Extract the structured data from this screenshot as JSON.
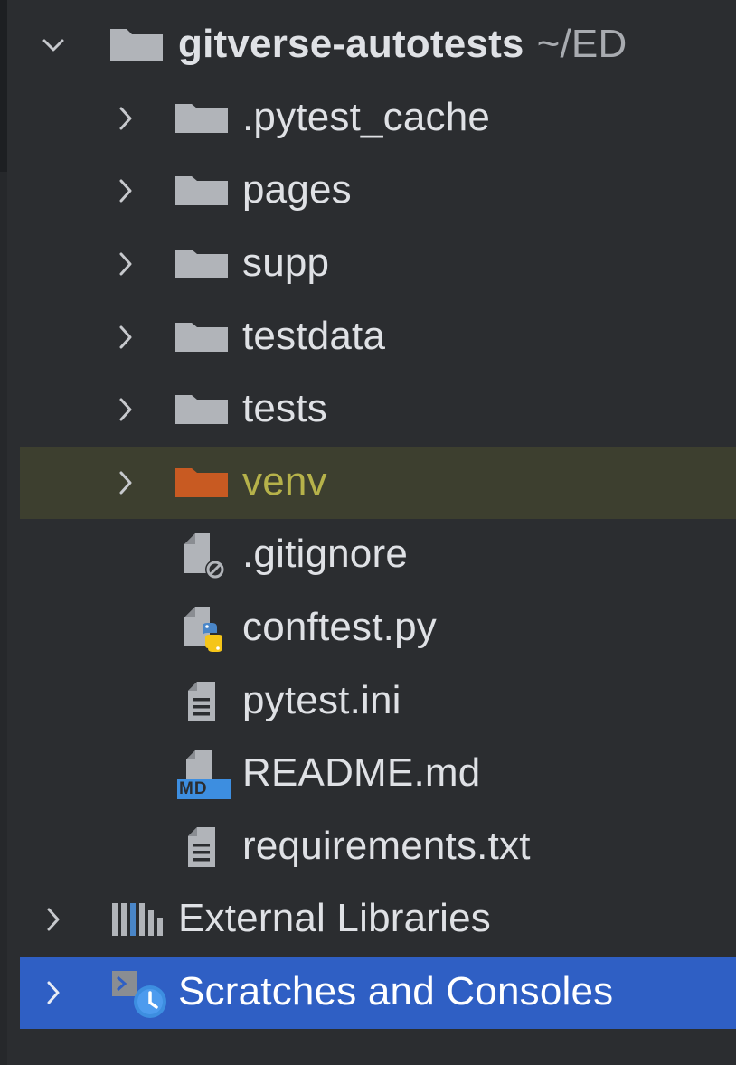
{
  "project": {
    "name": "gitverse-autotests",
    "path": "~/ED"
  },
  "folders": [
    {
      "label": ".pytest_cache"
    },
    {
      "label": "pages"
    },
    {
      "label": "supp"
    },
    {
      "label": "testdata"
    },
    {
      "label": "tests"
    },
    {
      "label": "venv",
      "excluded": true
    }
  ],
  "files": [
    {
      "label": ".gitignore",
      "icon": "gitignore-file-icon"
    },
    {
      "label": "conftest.py",
      "icon": "python-file-icon"
    },
    {
      "label": "pytest.ini",
      "icon": "text-file-icon"
    },
    {
      "label": "README.md",
      "icon": "markdown-file-icon",
      "badge": "MD"
    },
    {
      "label": "requirements.txt",
      "icon": "text-file-icon"
    }
  ],
  "external_libraries": {
    "label": "External Libraries"
  },
  "scratches": {
    "label": "Scratches and Consoles"
  },
  "colors": {
    "background": "#2b2d30",
    "folder": "#b1b4b9",
    "excluded_folder": "#c85a22",
    "excluded_text": "#b6b24a",
    "selection": "#2f5fc4",
    "highlight_row": "#3d3f2f"
  }
}
